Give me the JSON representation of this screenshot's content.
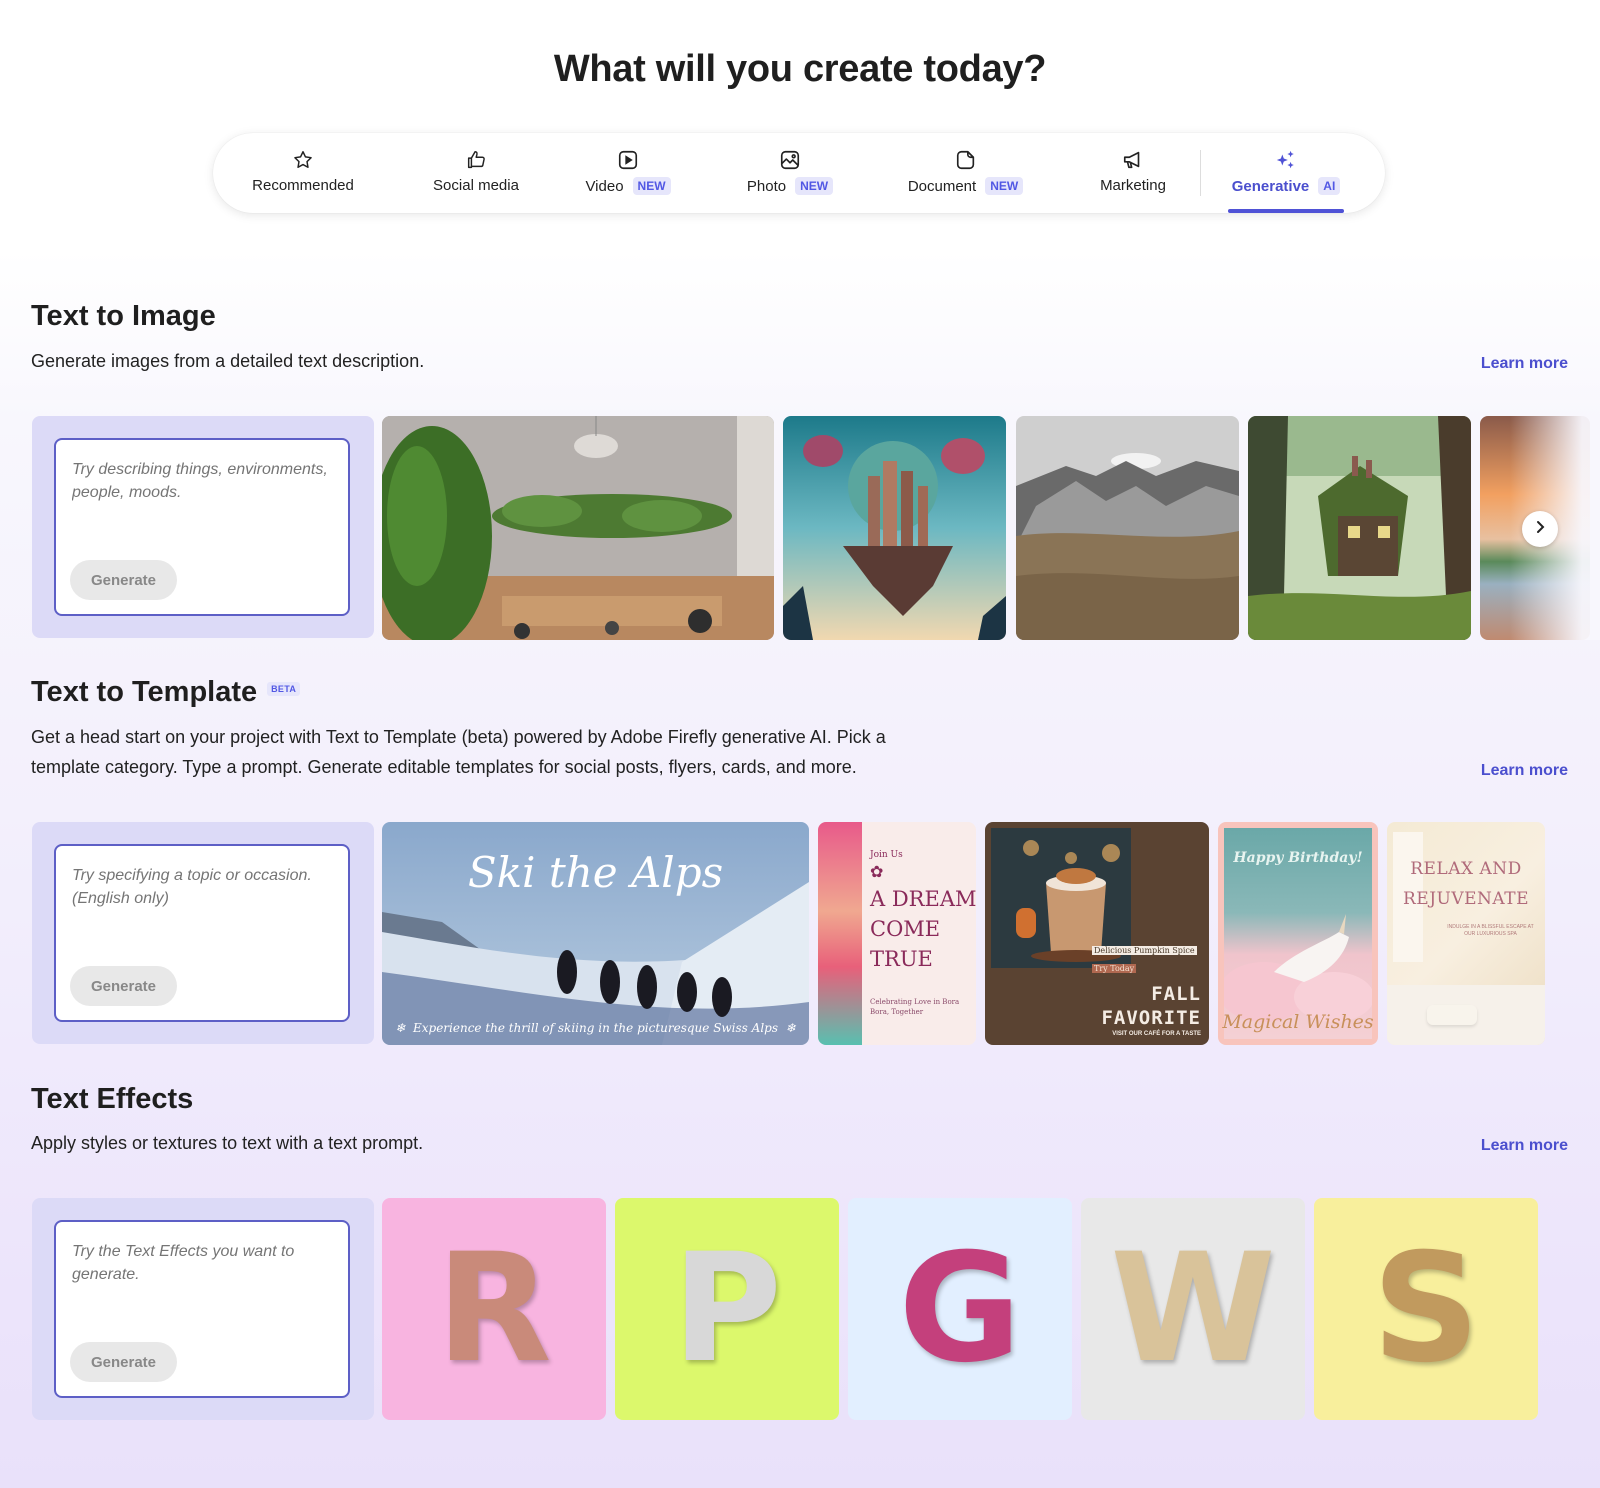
{
  "header": {
    "title": "What will you create today?"
  },
  "tabs": [
    {
      "label": "Recommended",
      "icon": "star-icon",
      "badge": null
    },
    {
      "label": "Social media",
      "icon": "thumbs-up-icon",
      "badge": null
    },
    {
      "label": "Video",
      "icon": "play-icon",
      "badge": "NEW"
    },
    {
      "label": "Photo",
      "icon": "image-icon",
      "badge": "NEW"
    },
    {
      "label": "Document",
      "icon": "document-icon",
      "badge": "NEW"
    },
    {
      "label": "Marketing",
      "icon": "megaphone-icon",
      "badge": null
    },
    {
      "label": "Generative",
      "icon": "sparkles-icon",
      "badge": "AI",
      "active": true
    }
  ],
  "sections": {
    "text_to_image": {
      "title": "Text to Image",
      "description": "Generate images from a detailed text description.",
      "learn_more": "Learn more",
      "prompt_placeholder": "Try describing things, environments, people, moods.",
      "generate_label": "Generate",
      "examples": [
        "plant-room",
        "floating-city",
        "mountain-landscape",
        "treehouse-forest",
        "sunset-lake"
      ]
    },
    "text_to_template": {
      "title": "Text to Template",
      "badge": "BETA",
      "description": "Get a head start on your project with Text to Template (beta) powered by Adobe Firefly generative AI. Pick a template category. Type a prompt. Generate editable templates for social posts, flyers, cards, and more.",
      "learn_more": "Learn more",
      "prompt_placeholder": "Try specifying a topic or occasion. (English only)",
      "generate_label": "Generate",
      "templates": {
        "ski": {
          "title": "Ski the Alps",
          "caption": "Experience the thrill of skiing in the picturesque Swiss Alps"
        },
        "dream": {
          "eyebrow": "Join Us",
          "title_lines": [
            "A DREAM",
            "COME",
            "TRUE"
          ],
          "caption": "Celebrating Love in Bora Bora, Together"
        },
        "fall": {
          "tag1": "Delicious Pumpkin Spice",
          "tag2": "Try Today",
          "title_lines": [
            "FALL",
            "FAVORITE"
          ],
          "caption": "VISIT OUR CAFÉ FOR A TASTE"
        },
        "birthday": {
          "title": "Happy Birthday!",
          "caption": "Magical Wishes"
        },
        "spa": {
          "title_lines": [
            "Relax and",
            "Rejuvenate"
          ],
          "caption": "Indulge in a blissful escape at our luxurious spa"
        }
      }
    },
    "text_effects": {
      "title": "Text Effects",
      "description": "Apply styles or textures to text with a text prompt.",
      "learn_more": "Learn more",
      "prompt_placeholder": "Try the Text Effects you want to generate.",
      "generate_label": "Generate",
      "letters": [
        {
          "char": "R",
          "bg": "#f8b4e0",
          "color": "#c98a7a"
        },
        {
          "char": "P",
          "bg": "#dcf86c",
          "color": "#d8d8d8"
        },
        {
          "char": "G",
          "bg": "#e2efff",
          "color": "#c4407c"
        },
        {
          "char": "W",
          "bg": "#e8e8e8",
          "color": "#d9c39a"
        },
        {
          "char": "S",
          "bg": "#f8ef9c",
          "color": "#c19a5e"
        }
      ]
    }
  },
  "colors": {
    "accent": "#4f52d6",
    "panel": "#dcdaf7",
    "badge_bg": "#e6e6fb"
  }
}
